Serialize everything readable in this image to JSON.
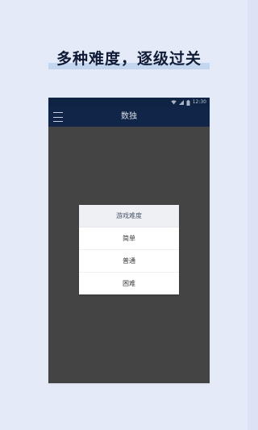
{
  "headline": "多种难度，逐级过关",
  "status_bar": {
    "time": "12:30",
    "icons": [
      "wifi-icon",
      "signal-icon",
      "battery-icon"
    ]
  },
  "app_bar": {
    "title": "数独",
    "menu_icon": "hamburger-menu-icon"
  },
  "dialog": {
    "title": "游戏难度",
    "options": [
      {
        "label": "简单"
      },
      {
        "label": "普通"
      },
      {
        "label": "困难"
      }
    ]
  },
  "colors": {
    "page_background": "#e4eaf7",
    "headline_text": "#101c37",
    "headline_highlight": "#a9c2ea",
    "app_bar": "#112548",
    "overlay": "#444444",
    "dialog_background": "#ffffff",
    "dialog_header": "#eef0f4"
  }
}
